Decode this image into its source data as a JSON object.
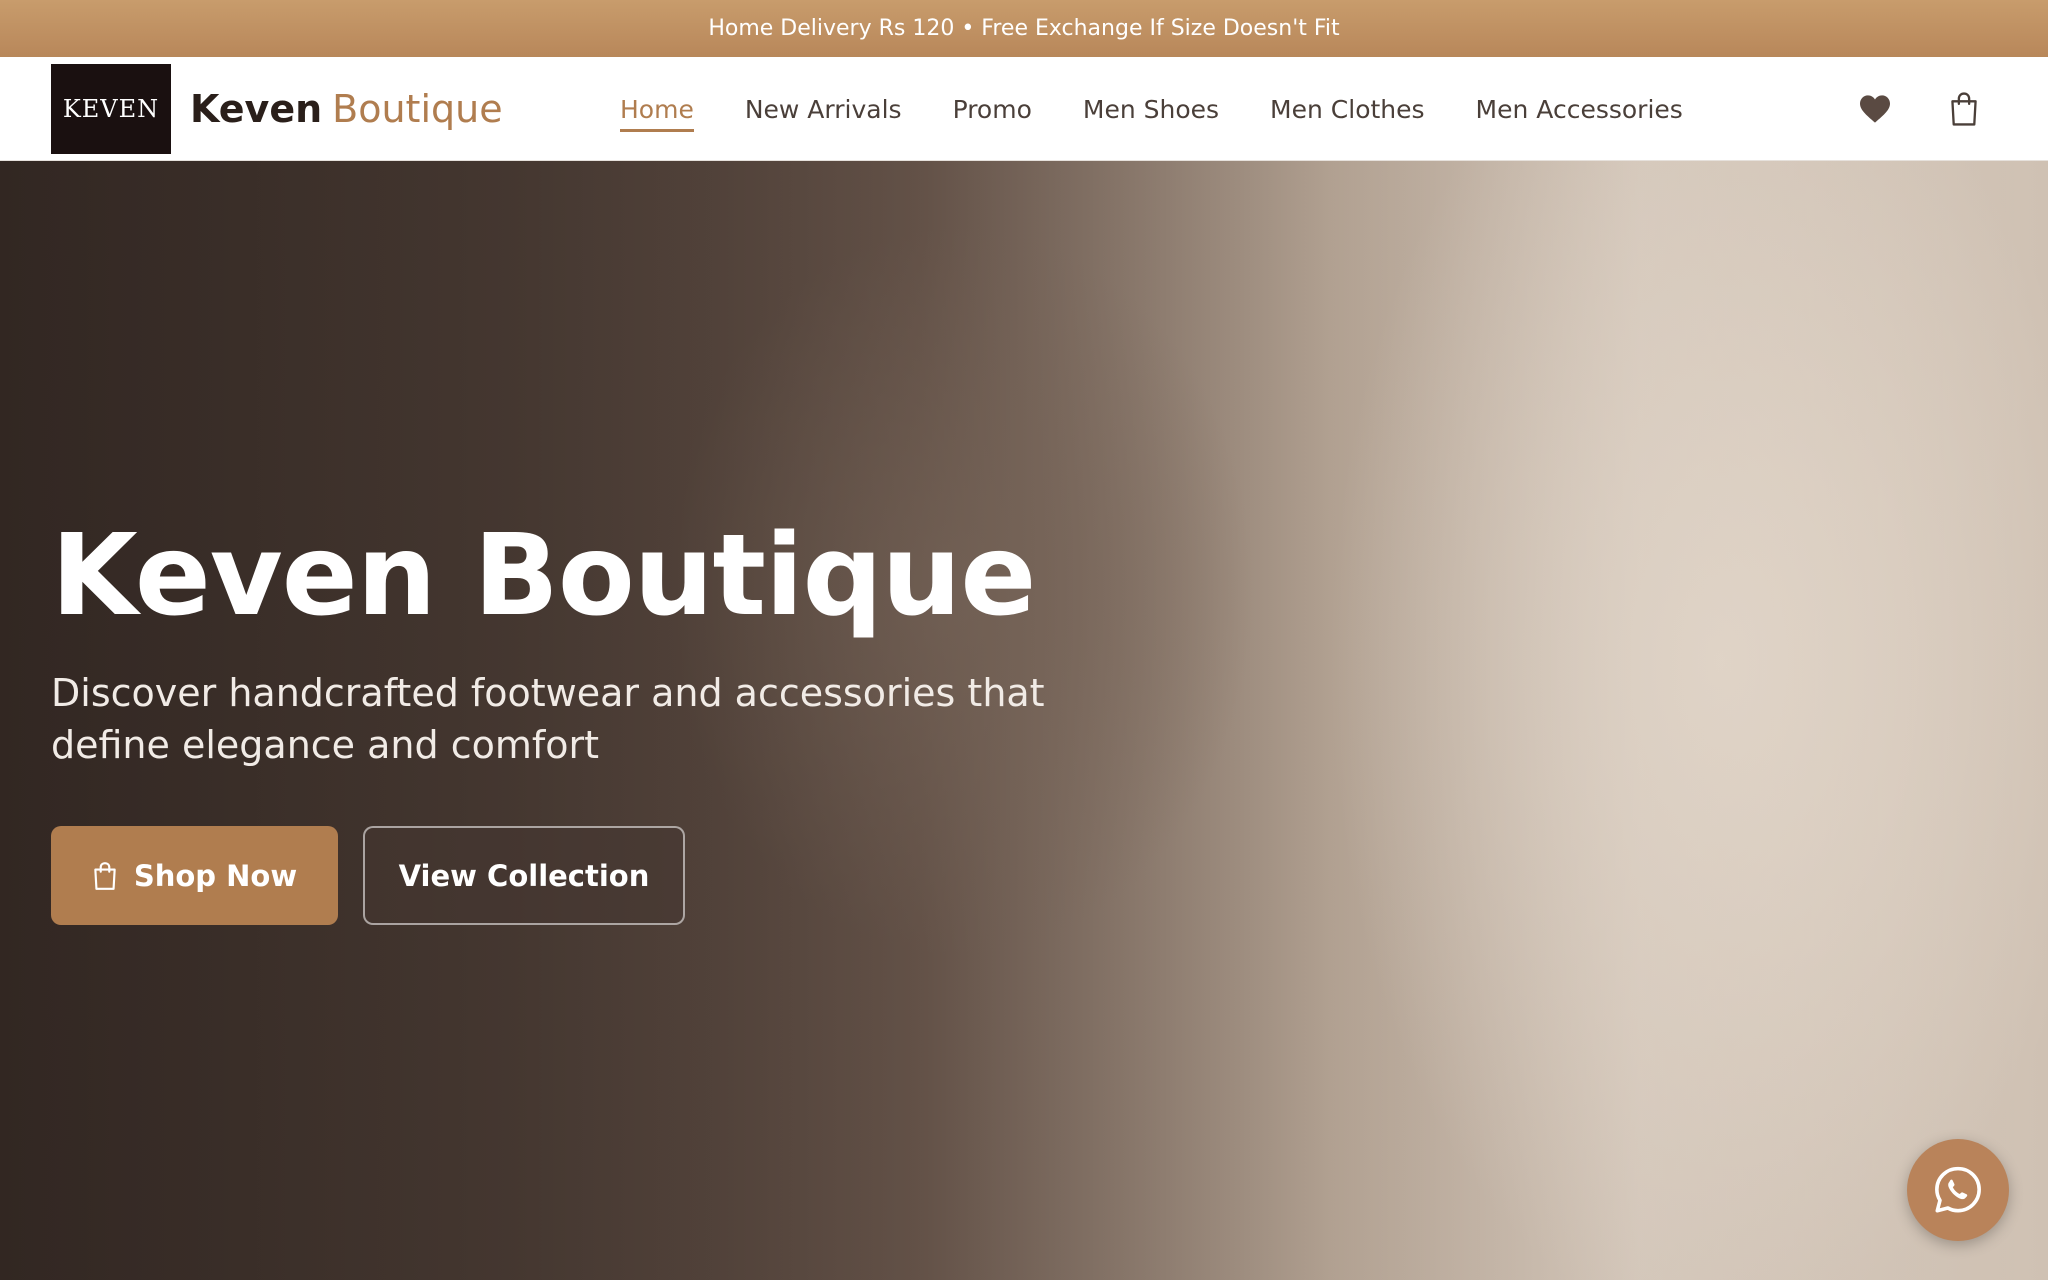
{
  "announcement": {
    "text": "Home Delivery Rs 120 • Free Exchange If Size Doesn't Fit"
  },
  "header": {
    "logo_text": "KEVEN",
    "brand_primary": "Keven",
    "brand_secondary": "Boutique",
    "nav": [
      {
        "label": "Home",
        "active": true
      },
      {
        "label": "New Arrivals",
        "active": false
      },
      {
        "label": "Promo",
        "active": false
      },
      {
        "label": "Men Shoes",
        "active": false
      },
      {
        "label": "Men Clothes",
        "active": false
      },
      {
        "label": "Men Accessories",
        "active": false
      }
    ],
    "icons": [
      "heart-icon",
      "shopping-bag-icon"
    ]
  },
  "hero": {
    "title": "Keven Boutique",
    "subtitle": "Discover handcrafted footwear and accessories that define elegance and comfort",
    "primary_button": "Shop Now",
    "secondary_button": "View Collection"
  },
  "floating": {
    "icon": "whatsapp-icon"
  },
  "colors": {
    "accent": "#b07d4f",
    "announcement_bg": "#c0905f",
    "logo_bg": "#1a1010",
    "text_dark": "#2a1f1a",
    "whatsapp_bg": "#b9835a"
  }
}
